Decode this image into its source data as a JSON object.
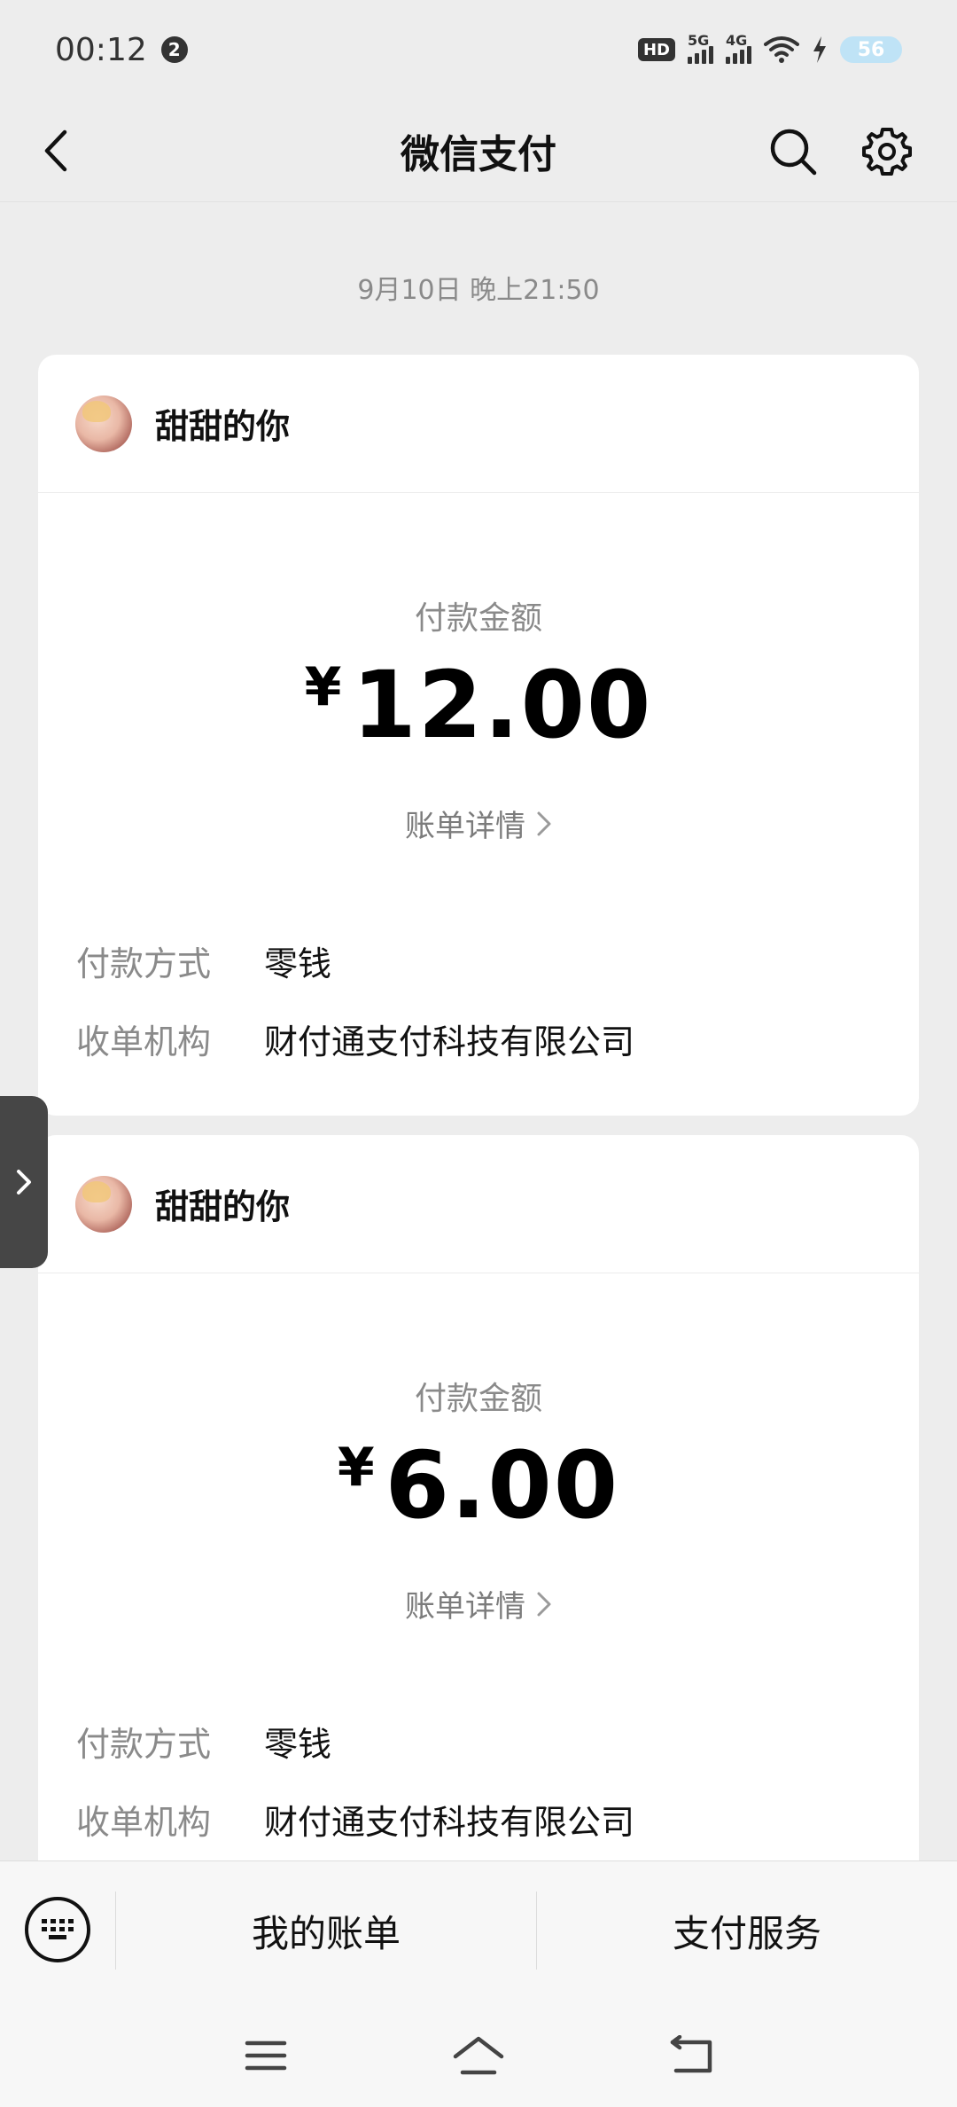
{
  "status_bar": {
    "time": "00:12",
    "notification_count": "2",
    "hd_label": "HD",
    "signal_5g": "5G",
    "signal_4g": "4G",
    "battery": "56"
  },
  "nav": {
    "title": "微信支付"
  },
  "date_label": "9月10日 晚上21:50",
  "cards": [
    {
      "merchant": "甜甜的你",
      "amount_label": "付款金额",
      "currency": "¥",
      "amount": "12.00",
      "bill_detail": "账单详情",
      "method_key": "付款方式",
      "method_value": "零钱",
      "acquirer_key": "收单机构",
      "acquirer_value": "财付通支付科技有限公司"
    },
    {
      "merchant": "甜甜的你",
      "amount_label": "付款金额",
      "currency": "¥",
      "amount": "6.00",
      "bill_detail": "账单详情",
      "method_key": "付款方式",
      "method_value": "零钱",
      "acquirer_key": "收单机构",
      "acquirer_value": "财付通支付科技有限公司"
    }
  ],
  "bottom_menu": {
    "my_bills": "我的账单",
    "pay_services": "支付服务"
  }
}
